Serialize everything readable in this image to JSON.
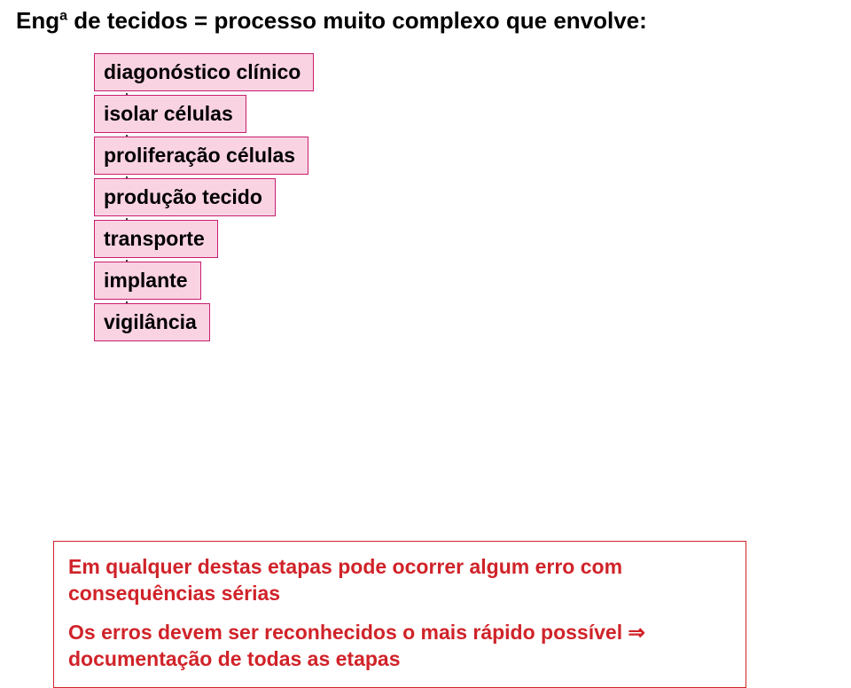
{
  "title": {
    "prefix": "Eng",
    "super": "a",
    "rest": " de tecidos = processo muito complexo que envolve:"
  },
  "steps": [
    "diagonóstico clínico",
    "isolar células",
    "proliferação células",
    "produção tecido",
    "transporte",
    "implante",
    "vigilância"
  ],
  "annotation": {
    "line1": "Em qualquer destas etapas pode ocorrer algum erro com consequências sérias",
    "line2": "Os erros devem ser reconhecidos o mais rápido possível ⇒ documentação de todas as etapas"
  },
  "chart_data": {
    "type": "flowchart",
    "title": "Engª de tecidos = processo muito complexo que envolve:",
    "nodes": [
      {
        "id": "n1",
        "label": "diagonóstico clínico"
      },
      {
        "id": "n2",
        "label": "isolar células"
      },
      {
        "id": "n3",
        "label": "proliferação células"
      },
      {
        "id": "n4",
        "label": "produção tecido"
      },
      {
        "id": "n5",
        "label": "transporte"
      },
      {
        "id": "n6",
        "label": "implante"
      },
      {
        "id": "n7",
        "label": "vigilância"
      }
    ],
    "edges": [
      {
        "from": "n1",
        "to": "n2"
      },
      {
        "from": "n2",
        "to": "n3"
      },
      {
        "from": "n3",
        "to": "n4"
      },
      {
        "from": "n4",
        "to": "n5"
      },
      {
        "from": "n5",
        "to": "n6"
      },
      {
        "from": "n6",
        "to": "n7"
      }
    ],
    "annotation_box": [
      "Em qualquer destas etapas pode ocorrer algum erro com consequências sérias",
      "Os erros devem ser reconhecidos o mais rápido possível ⇒ documentação de todas as etapas"
    ]
  }
}
